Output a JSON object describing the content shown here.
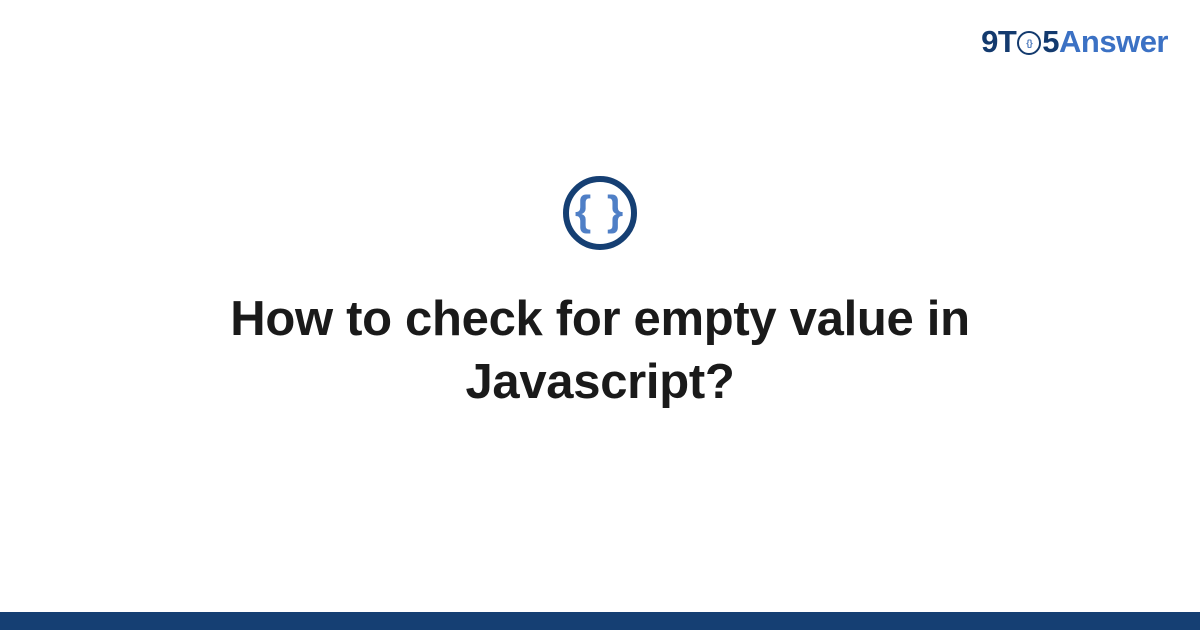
{
  "logo": {
    "part1": "9T",
    "clock_inner": "{}",
    "part2": "5",
    "part3": "Answer"
  },
  "icon": {
    "glyph": "{ }"
  },
  "title": "How to check for empty value in Javascript?",
  "colors": {
    "brand_dark": "#153f73",
    "brand_light": "#3b71c4",
    "icon_brace": "#4f7fc6"
  }
}
